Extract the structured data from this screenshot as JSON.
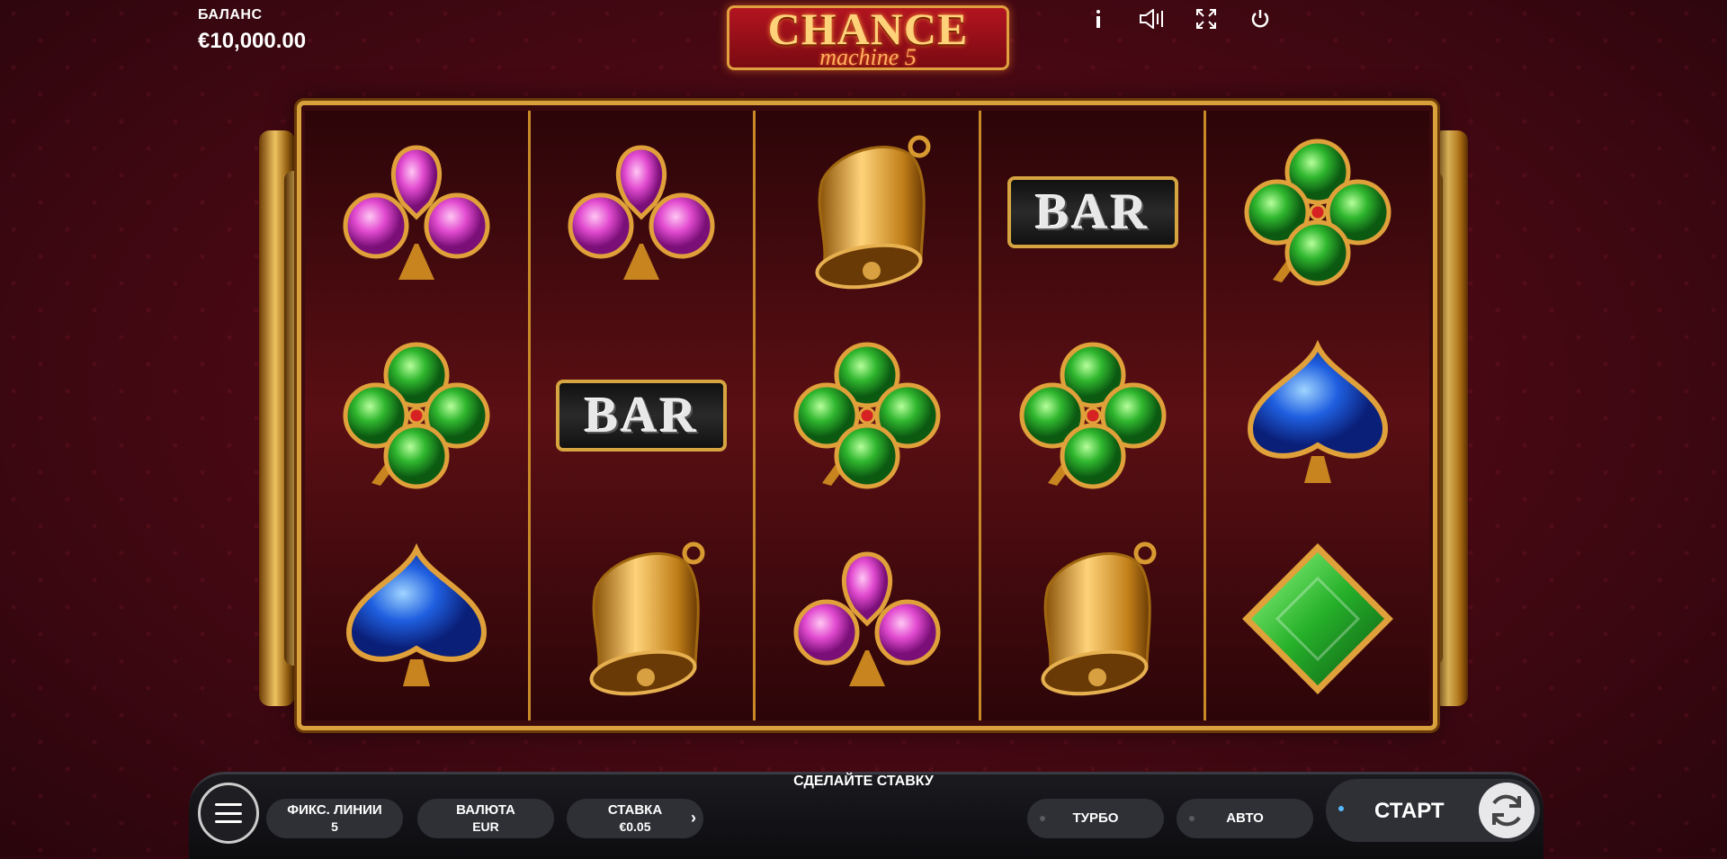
{
  "balance": {
    "label": "БАЛАНС",
    "value": "€10,000.00"
  },
  "logo": {
    "title": "CHANCE",
    "subtitle": "machine 5"
  },
  "top_icons": [
    "info-icon",
    "sound-icon",
    "fullscreen-icon",
    "power-icon"
  ],
  "reels": [
    [
      "club",
      "clover",
      "spade"
    ],
    [
      "club",
      "bar",
      "bell"
    ],
    [
      "bell",
      "clover",
      "club"
    ],
    [
      "bar",
      "clover",
      "bell"
    ],
    [
      "clover",
      "spade",
      "diamond"
    ]
  ],
  "symbols": {
    "bar_text": "BAR"
  },
  "bottom": {
    "prompt": "СДЕЛАЙТЕ СТАВКУ",
    "lines_label": "ФИКС. ЛИНИИ",
    "lines_value": "5",
    "currency_label": "ВАЛЮТА",
    "currency_value": "EUR",
    "bet_label": "СТАВКА",
    "bet_value": "€0.05",
    "turbo_label": "ТУРБО",
    "auto_label": "АВТО",
    "start_label": "СТАРТ"
  },
  "colors": {
    "gold": "#d8a13c",
    "bg": "#4a0914",
    "accent": "#56b8ff"
  }
}
